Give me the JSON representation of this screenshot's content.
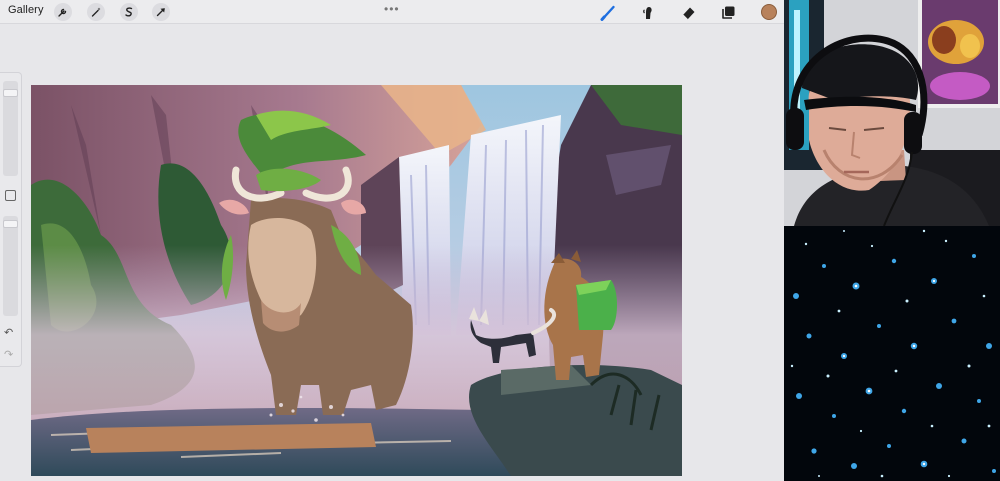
{
  "toolbar": {
    "gallery_label": "Gallery",
    "left_tools": [
      {
        "name": "actions-wrench-icon"
      },
      {
        "name": "adjustments-wand-icon"
      },
      {
        "name": "selection-s-icon"
      },
      {
        "name": "transform-arrow-icon"
      }
    ],
    "more_label": "•••",
    "right_tools": [
      {
        "name": "brush-icon",
        "active": true
      },
      {
        "name": "smudge-icon"
      },
      {
        "name": "eraser-icon"
      },
      {
        "name": "layers-icon"
      }
    ],
    "active_color": "#b8825c",
    "accent_color": "#1f6fe0"
  },
  "sidebar": {
    "undo_glyph": "↶",
    "redo_glyph": "↷"
  },
  "canvas": {
    "subject": "painting-waterfall-bull-bear-fox"
  },
  "webcam": {
    "subject": "streamer-with-headphones"
  },
  "overlay": {
    "subject": "starfield"
  }
}
